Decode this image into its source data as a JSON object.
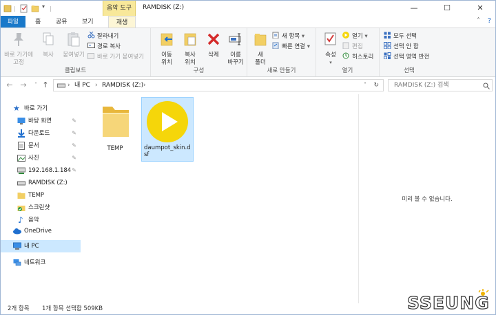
{
  "window": {
    "title": "RAMDISK (Z:)",
    "context_tab": "음악 도구",
    "minimize": "—",
    "maximize": "☐",
    "close": "✕"
  },
  "tabs": [
    {
      "label": "파일"
    },
    {
      "label": "홈"
    },
    {
      "label": "공유"
    },
    {
      "label": "보기"
    },
    {
      "label": "재생"
    }
  ],
  "ribbon": {
    "clipboard": {
      "label": "클립보드",
      "pin": "바로 가기에\n고정",
      "copy": "복사",
      "paste": "붙여넣기",
      "cut": "잘라내기",
      "copy_path": "경로 복사",
      "paste_shortcut": "바로 가기 붙여넣기"
    },
    "organize": {
      "label": "구성",
      "move_to": "이동\n위치",
      "copy_to": "복사\n위치",
      "delete": "삭제",
      "rename": "이름\n바꾸기"
    },
    "new": {
      "label": "새로 만들기",
      "new_folder": "새\n폴더",
      "new_item": "새 항목",
      "easy_access": "빠른 연결"
    },
    "open": {
      "label": "열기",
      "properties": "속성",
      "open": "열기",
      "edit": "편집",
      "history": "히스토리"
    },
    "select": {
      "label": "선택",
      "select_all": "모두 선택",
      "select_none": "선택 안 함",
      "invert": "선택 영역 반전"
    }
  },
  "address": {
    "path": [
      "내 PC",
      "RAMDISK (Z:)"
    ],
    "search_placeholder": "RAMDISK (Z:) 검색"
  },
  "nav": {
    "quick_access": "바로 가기",
    "items": [
      {
        "label": "바탕 화면",
        "pinned": true
      },
      {
        "label": "다운로드",
        "pinned": true
      },
      {
        "label": "문서",
        "pinned": true
      },
      {
        "label": "사진",
        "pinned": true
      },
      {
        "label": "192.168.1.184",
        "pinned": true
      },
      {
        "label": "RAMDISK (Z:)",
        "pinned": false
      },
      {
        "label": "TEMP",
        "pinned": false
      },
      {
        "label": "스크린샷",
        "pinned": false
      },
      {
        "label": "음악",
        "pinned": false
      }
    ],
    "onedrive": "OneDrive",
    "this_pc": "내 PC",
    "network": "네트워크",
    "pin_glyph": "📌"
  },
  "files": [
    {
      "name": "TEMP",
      "type": "folder"
    },
    {
      "name": "daumpot_skin.dsf",
      "type": "media",
      "selected": true
    }
  ],
  "preview": {
    "empty_text": "미리 볼 수 없습니다."
  },
  "status": {
    "item_count": "2개 항목",
    "selection": "1개 항목 선택함 509KB"
  },
  "watermark": {
    "text": "SSEUNG"
  },
  "colors": {
    "file_tab": "#1979ca",
    "selection": "#cce8ff",
    "context_tab": "#f8e89a",
    "media_circle": "#f5d60a"
  }
}
